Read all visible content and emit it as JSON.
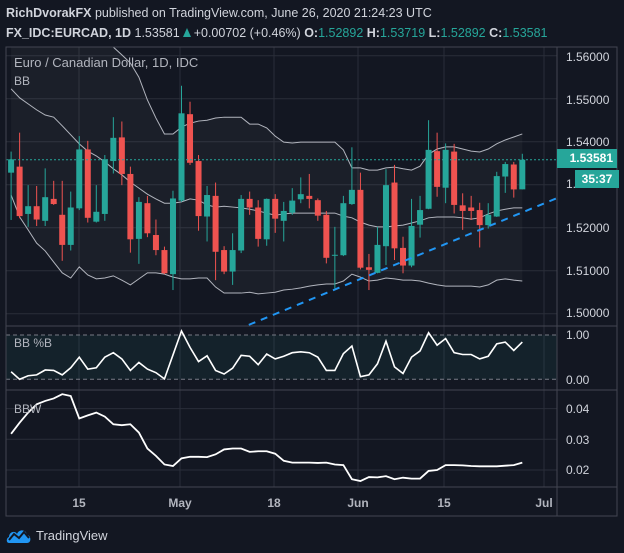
{
  "header": {
    "author": "RichDvorakFX",
    "published": "published on TradingView.com, June 26, 2020 21:24:23 UTC",
    "symbol": "FX_IDC:EURCAD, 1D",
    "last": "1.53581",
    "change": "+0.00702 (+0.46%)",
    "o_label": "O:",
    "o": "1.52892",
    "h_label": "H:",
    "h": "1.53719",
    "l_label": "L:",
    "l": "1.52892",
    "c_label": "C:",
    "c": "1.53581"
  },
  "main_pane": {
    "title": "Euro / Canadian Dollar, 1D, IDC",
    "indicator": "BB",
    "price_labels": [
      "1.56000",
      "1.55000",
      "1.54000",
      "1.52000",
      "1.51000",
      "1.50000"
    ],
    "hidden_label_fragment": "1.",
    "current_price": "1.53581",
    "countdown": "35:37"
  },
  "pctb_pane": {
    "title": "BB %B",
    "labels": [
      "1.00",
      "0.00"
    ]
  },
  "bbw_pane": {
    "title": "BBW",
    "labels": [
      "0.04",
      "0.03",
      "0.02"
    ]
  },
  "time_axis": [
    "15",
    "May",
    "18",
    "Jun",
    "15",
    "Jul"
  ],
  "footer": {
    "brand": "TradingView"
  },
  "colors": {
    "up": "#26a69a",
    "down": "#ef5350",
    "bands": "#b2b5be",
    "trendline": "#2196f3",
    "background": "#131722"
  },
  "chart_data": [
    {
      "type": "candlestick",
      "title": "Euro / Canadian Dollar, 1D, IDC",
      "ylim": [
        1.4975,
        1.5625
      ],
      "price_ticks": [
        1.5,
        1.51,
        1.52,
        1.53,
        1.54,
        1.55,
        1.56
      ],
      "ohlc": [
        [
          1.5328,
          1.5377,
          1.5218,
          1.5359
        ],
        [
          1.5342,
          1.5421,
          1.5222,
          1.5227
        ],
        [
          1.5232,
          1.5299,
          1.5202,
          1.525
        ],
        [
          1.525,
          1.5297,
          1.5204,
          1.5219
        ],
        [
          1.5216,
          1.5338,
          1.5204,
          1.5271
        ],
        [
          1.5267,
          1.5309,
          1.5253,
          1.5255
        ],
        [
          1.523,
          1.5309,
          1.5123,
          1.516
        ],
        [
          1.516,
          1.5284,
          1.5147,
          1.5247
        ],
        [
          1.5245,
          1.5413,
          1.5241,
          1.5382
        ],
        [
          1.5382,
          1.5402,
          1.5212,
          1.5223
        ],
        [
          1.5214,
          1.5299,
          1.5212,
          1.5237
        ],
        [
          1.5232,
          1.5369,
          1.5216,
          1.5359
        ],
        [
          1.5355,
          1.5457,
          1.5326,
          1.5409
        ],
        [
          1.541,
          1.5447,
          1.5299,
          1.5325
        ],
        [
          1.5325,
          1.5342,
          1.5142,
          1.5173
        ],
        [
          1.5174,
          1.5271,
          1.5116,
          1.526
        ],
        [
          1.5257,
          1.5274,
          1.5178,
          1.5187
        ],
        [
          1.5183,
          1.5219,
          1.5136,
          1.5148
        ],
        [
          1.5148,
          1.5156,
          1.5092,
          1.5094
        ],
        [
          1.5092,
          1.5286,
          1.5055,
          1.5268
        ],
        [
          1.5263,
          1.553,
          1.526,
          1.5466
        ],
        [
          1.5464,
          1.5493,
          1.5346,
          1.5351
        ],
        [
          1.5355,
          1.5369,
          1.5193,
          1.5227
        ],
        [
          1.5226,
          1.5297,
          1.5168,
          1.5276
        ],
        [
          1.5274,
          1.5305,
          1.5078,
          1.5144
        ],
        [
          1.5148,
          1.5157,
          1.5092,
          1.5098
        ],
        [
          1.5098,
          1.5187,
          1.5067,
          1.5148
        ],
        [
          1.5147,
          1.5276,
          1.5141,
          1.5267
        ],
        [
          1.5267,
          1.5284,
          1.523,
          1.5247
        ],
        [
          1.5247,
          1.5264,
          1.5156,
          1.5174
        ],
        [
          1.5173,
          1.5268,
          1.5158,
          1.5267
        ],
        [
          1.5267,
          1.5278,
          1.5188,
          1.5221
        ],
        [
          1.5216,
          1.526,
          1.5168,
          1.5239
        ],
        [
          1.5235,
          1.5292,
          1.523,
          1.5263
        ],
        [
          1.5266,
          1.5317,
          1.5257,
          1.5278
        ],
        [
          1.5274,
          1.5325,
          1.5245,
          1.5267
        ],
        [
          1.5264,
          1.5268,
          1.5216,
          1.5228
        ],
        [
          1.523,
          1.5239,
          1.5117,
          1.513
        ],
        [
          1.5136,
          1.5202,
          1.5059,
          1.5137
        ],
        [
          1.5136,
          1.5274,
          1.5134,
          1.5257
        ],
        [
          1.5255,
          1.5387,
          1.5253,
          1.5288
        ],
        [
          1.5288,
          1.5328,
          1.5103,
          1.5107
        ],
        [
          1.5108,
          1.5139,
          1.5055,
          1.5102
        ],
        [
          1.5095,
          1.5202,
          1.5094,
          1.516
        ],
        [
          1.5157,
          1.5336,
          1.5113,
          1.5299
        ],
        [
          1.5305,
          1.5346,
          1.5125,
          1.5152
        ],
        [
          1.5153,
          1.5179,
          1.5094,
          1.5112
        ],
        [
          1.5112,
          1.5267,
          1.5108,
          1.5204
        ],
        [
          1.5207,
          1.5274,
          1.5177,
          1.5241
        ],
        [
          1.5244,
          1.545,
          1.5243,
          1.5381
        ],
        [
          1.5378,
          1.5421,
          1.5272,
          1.5295
        ],
        [
          1.5293,
          1.5396,
          1.5257,
          1.5381
        ],
        [
          1.5377,
          1.5395,
          1.5233,
          1.5253
        ],
        [
          1.5252,
          1.528,
          1.5195,
          1.5239
        ],
        [
          1.5247,
          1.5274,
          1.5218,
          1.5239
        ],
        [
          1.5241,
          1.5258,
          1.5154,
          1.5206
        ],
        [
          1.5206,
          1.5257,
          1.5198,
          1.523
        ],
        [
          1.5226,
          1.533,
          1.5225,
          1.532
        ],
        [
          1.5319,
          1.5353,
          1.5281,
          1.5348
        ],
        [
          1.5347,
          1.5353,
          1.527,
          1.5289
        ],
        [
          1.52892,
          1.53719,
          1.52892,
          1.53581
        ]
      ],
      "bb_upper": [
        1.5853,
        1.5834,
        1.5815,
        1.5795,
        1.5776,
        1.5758,
        1.5737,
        1.5718,
        1.5699,
        1.5678,
        1.566,
        1.5641,
        1.562,
        1.5602,
        1.5583,
        1.555,
        1.5497,
        1.5455,
        1.5418,
        1.5418,
        1.5434,
        1.5443,
        1.5448,
        1.545,
        1.5455,
        1.5457,
        1.5457,
        1.5457,
        1.5441,
        1.5441,
        1.5432,
        1.5413,
        1.5399,
        1.5397,
        1.5399,
        1.5399,
        1.5399,
        1.5399,
        1.5399,
        1.5381,
        1.5339,
        1.5339,
        1.5334,
        1.5334,
        1.5339,
        1.5341,
        1.5337,
        1.5334,
        1.5343,
        1.5371,
        1.5383,
        1.5388,
        1.5388,
        1.5383,
        1.5378,
        1.5376,
        1.5383,
        1.5395,
        1.5404,
        1.5411,
        1.5418
      ],
      "bb_middle": [
        1.5523,
        1.5502,
        1.5488,
        1.5474,
        1.5462,
        1.5457,
        1.5437,
        1.5416,
        1.5395,
        1.5378,
        1.5367,
        1.5353,
        1.5337,
        1.5323,
        1.5306,
        1.5292,
        1.5278,
        1.5267,
        1.5257,
        1.5257,
        1.526,
        1.5267,
        1.5264,
        1.5253,
        1.5248,
        1.525,
        1.5248,
        1.5246,
        1.5243,
        1.5239,
        1.5234,
        1.5229,
        1.5232,
        1.5234,
        1.5234,
        1.5234,
        1.5234,
        1.5234,
        1.5234,
        1.5227,
        1.5223,
        1.5213,
        1.5206,
        1.5202,
        1.5202,
        1.5204,
        1.5206,
        1.5211,
        1.5216,
        1.5223,
        1.5225,
        1.5225,
        1.5225,
        1.5223,
        1.522,
        1.5223,
        1.5232,
        1.5239,
        1.5243,
        1.5246,
        1.5246
      ],
      "bb_lower": [
        1.5276,
        1.5225,
        1.5195,
        1.5164,
        1.5146,
        1.512,
        1.5095,
        1.5083,
        1.5109,
        1.509,
        1.5081,
        1.5083,
        1.5088,
        1.5078,
        1.5067,
        1.5081,
        1.5095,
        1.5095,
        1.5092,
        1.5085,
        1.5081,
        1.5081,
        1.5083,
        1.5083,
        1.5062,
        1.5048,
        1.5048,
        1.5048,
        1.505,
        1.5046,
        1.5048,
        1.505,
        1.5055,
        1.5057,
        1.506,
        1.5064,
        1.5067,
        1.5069,
        1.5069,
        1.5076,
        1.5092,
        1.5085,
        1.5076,
        1.5078,
        1.5083,
        1.5081,
        1.5078,
        1.5078,
        1.5076,
        1.5071,
        1.5067,
        1.5064,
        1.5064,
        1.5064,
        1.5064,
        1.5062,
        1.5067,
        1.5078,
        1.5081,
        1.5078,
        1.5076
      ],
      "trendline": {
        "from": {
          "bar": 27.9,
          "price": 1.4974
        },
        "to": {
          "bar": 64.1,
          "price": 1.5269
        },
        "style": "dashed"
      },
      "last_price_line": 1.53581
    },
    {
      "type": "line",
      "title": "BB %B",
      "ylim": [
        -0.2,
        1.25
      ],
      "ticks": [
        0.0,
        1.0
      ],
      "values": [
        0.17,
        0,
        0.08,
        0.1,
        0.21,
        0.2,
        0.1,
        0.26,
        0.5,
        0.23,
        0.26,
        0.5,
        0.6,
        0.46,
        0.2,
        0.38,
        0.23,
        0.15,
        0.01,
        0.55,
        1.09,
        0.72,
        0.4,
        0.53,
        0.2,
        0.12,
        0.25,
        0.54,
        0.52,
        0.33,
        0.57,
        0.46,
        0.52,
        0.6,
        0.62,
        0.6,
        0.5,
        0.2,
        0.2,
        0.58,
        0.75,
        0.06,
        0.1,
        0.35,
        0.86,
        0.28,
        0.13,
        0.5,
        0.64,
        1.05,
        0.77,
        0.92,
        0.6,
        0.56,
        0.56,
        0.46,
        0.52,
        0.8,
        0.84,
        0.65,
        0.84
      ]
    },
    {
      "type": "line",
      "title": "BBW",
      "ticks": [
        0.02,
        0.03,
        0.04
      ],
      "values": [
        0.0318,
        0.0354,
        0.0387,
        0.0414,
        0.0425,
        0.0433,
        0.0447,
        0.0441,
        0.0368,
        0.0378,
        0.0387,
        0.0374,
        0.0349,
        0.0346,
        0.0349,
        0.0322,
        0.027,
        0.0246,
        0.0218,
        0.0213,
        0.0238,
        0.0243,
        0.0243,
        0.0242,
        0.0251,
        0.0267,
        0.027,
        0.027,
        0.0259,
        0.0261,
        0.0261,
        0.0253,
        0.023,
        0.0224,
        0.0224,
        0.0224,
        0.0223,
        0.0224,
        0.0218,
        0.0216,
        0.017,
        0.0164,
        0.0177,
        0.0176,
        0.018,
        0.017,
        0.0175,
        0.0172,
        0.0172,
        0.0197,
        0.02,
        0.0216,
        0.0216,
        0.0215,
        0.0213,
        0.0212,
        0.0212,
        0.0212,
        0.0214,
        0.0216,
        0.0224
      ]
    }
  ]
}
